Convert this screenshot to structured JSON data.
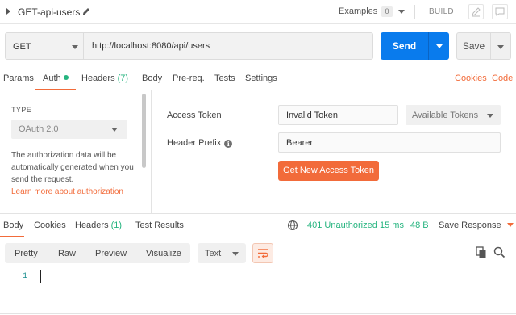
{
  "request": {
    "name": "GET-api-users",
    "examples_label": "Examples",
    "examples_count": "0",
    "build_label": "BUILD"
  },
  "url_bar": {
    "method": "GET",
    "url": "http://localhost:8080/api/users",
    "send_label": "Send",
    "save_label": "Save"
  },
  "request_tabs": {
    "params": "Params",
    "auth": "Auth",
    "headers": "Headers",
    "headers_count": "(7)",
    "body": "Body",
    "prereq": "Pre-req.",
    "tests": "Tests",
    "settings": "Settings",
    "cookies": "Cookies",
    "code": "Code"
  },
  "auth": {
    "type_label": "TYPE",
    "type_value": "OAuth 2.0",
    "description": "The authorization data will be automatically generated when you send the request.",
    "learn_more": "Learn more about authorization",
    "access_token_label": "Access Token",
    "access_token_value": "Invalid Token",
    "available_tokens": "Available Tokens",
    "header_prefix_label": "Header Prefix",
    "header_prefix_value": "Bearer",
    "get_token_label": "Get New Access Token"
  },
  "response_tabs": {
    "body": "Body",
    "cookies": "Cookies",
    "headers": "Headers",
    "headers_count": "(1)",
    "test_results": "Test Results"
  },
  "response_status": {
    "status": "401 Unauthorized",
    "time": "15 ms",
    "size": "48 B",
    "save_response": "Save Response"
  },
  "response_toolbar": {
    "pretty": "Pretty",
    "raw": "Raw",
    "preview": "Preview",
    "visualize": "Visualize",
    "format": "Text"
  },
  "editor": {
    "line_number": "1"
  },
  "colors": {
    "accent_orange": "#f26b3a",
    "send_blue": "#097bed",
    "status_green": "#26b47f"
  }
}
